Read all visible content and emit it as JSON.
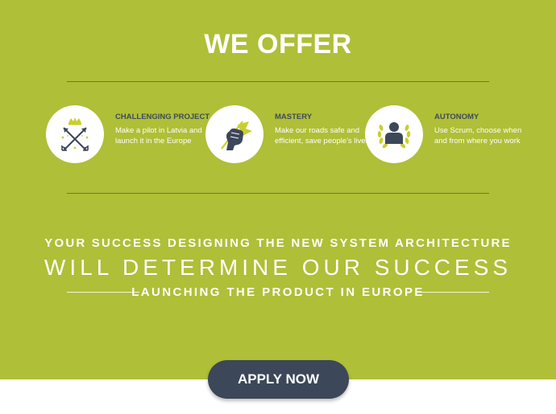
{
  "section": {
    "title": "WE OFFER"
  },
  "offers": [
    {
      "icon": "crossed-arrows-crown-icon",
      "heading": "CHALLENGING PROJECT",
      "description": "Make a pilot in Latvia and launch it in the Europe"
    },
    {
      "icon": "fist-flag-icon",
      "heading": "MASTERY",
      "description": "Make our roads safe and efficient, save people's lives"
    },
    {
      "icon": "person-laurel-icon",
      "heading": "AUTONOMY",
      "description": "Use Scrum, choose when and from where you work"
    }
  ],
  "tagline": {
    "line1": "YOUR SUCCESS DESIGNING THE NEW SYSTEM ARCHITECTURE",
    "line2": "WILL DETERMINE OUR SUCCESS",
    "line3": "LAUNCHING THE PRODUCT IN EUROPE"
  },
  "cta": {
    "label": "APPLY NOW"
  },
  "colors": {
    "background": "#afbf37",
    "accent_dark": "#3c4759",
    "icon_yellow": "#c8cf2d",
    "text_white": "#ffffff"
  }
}
